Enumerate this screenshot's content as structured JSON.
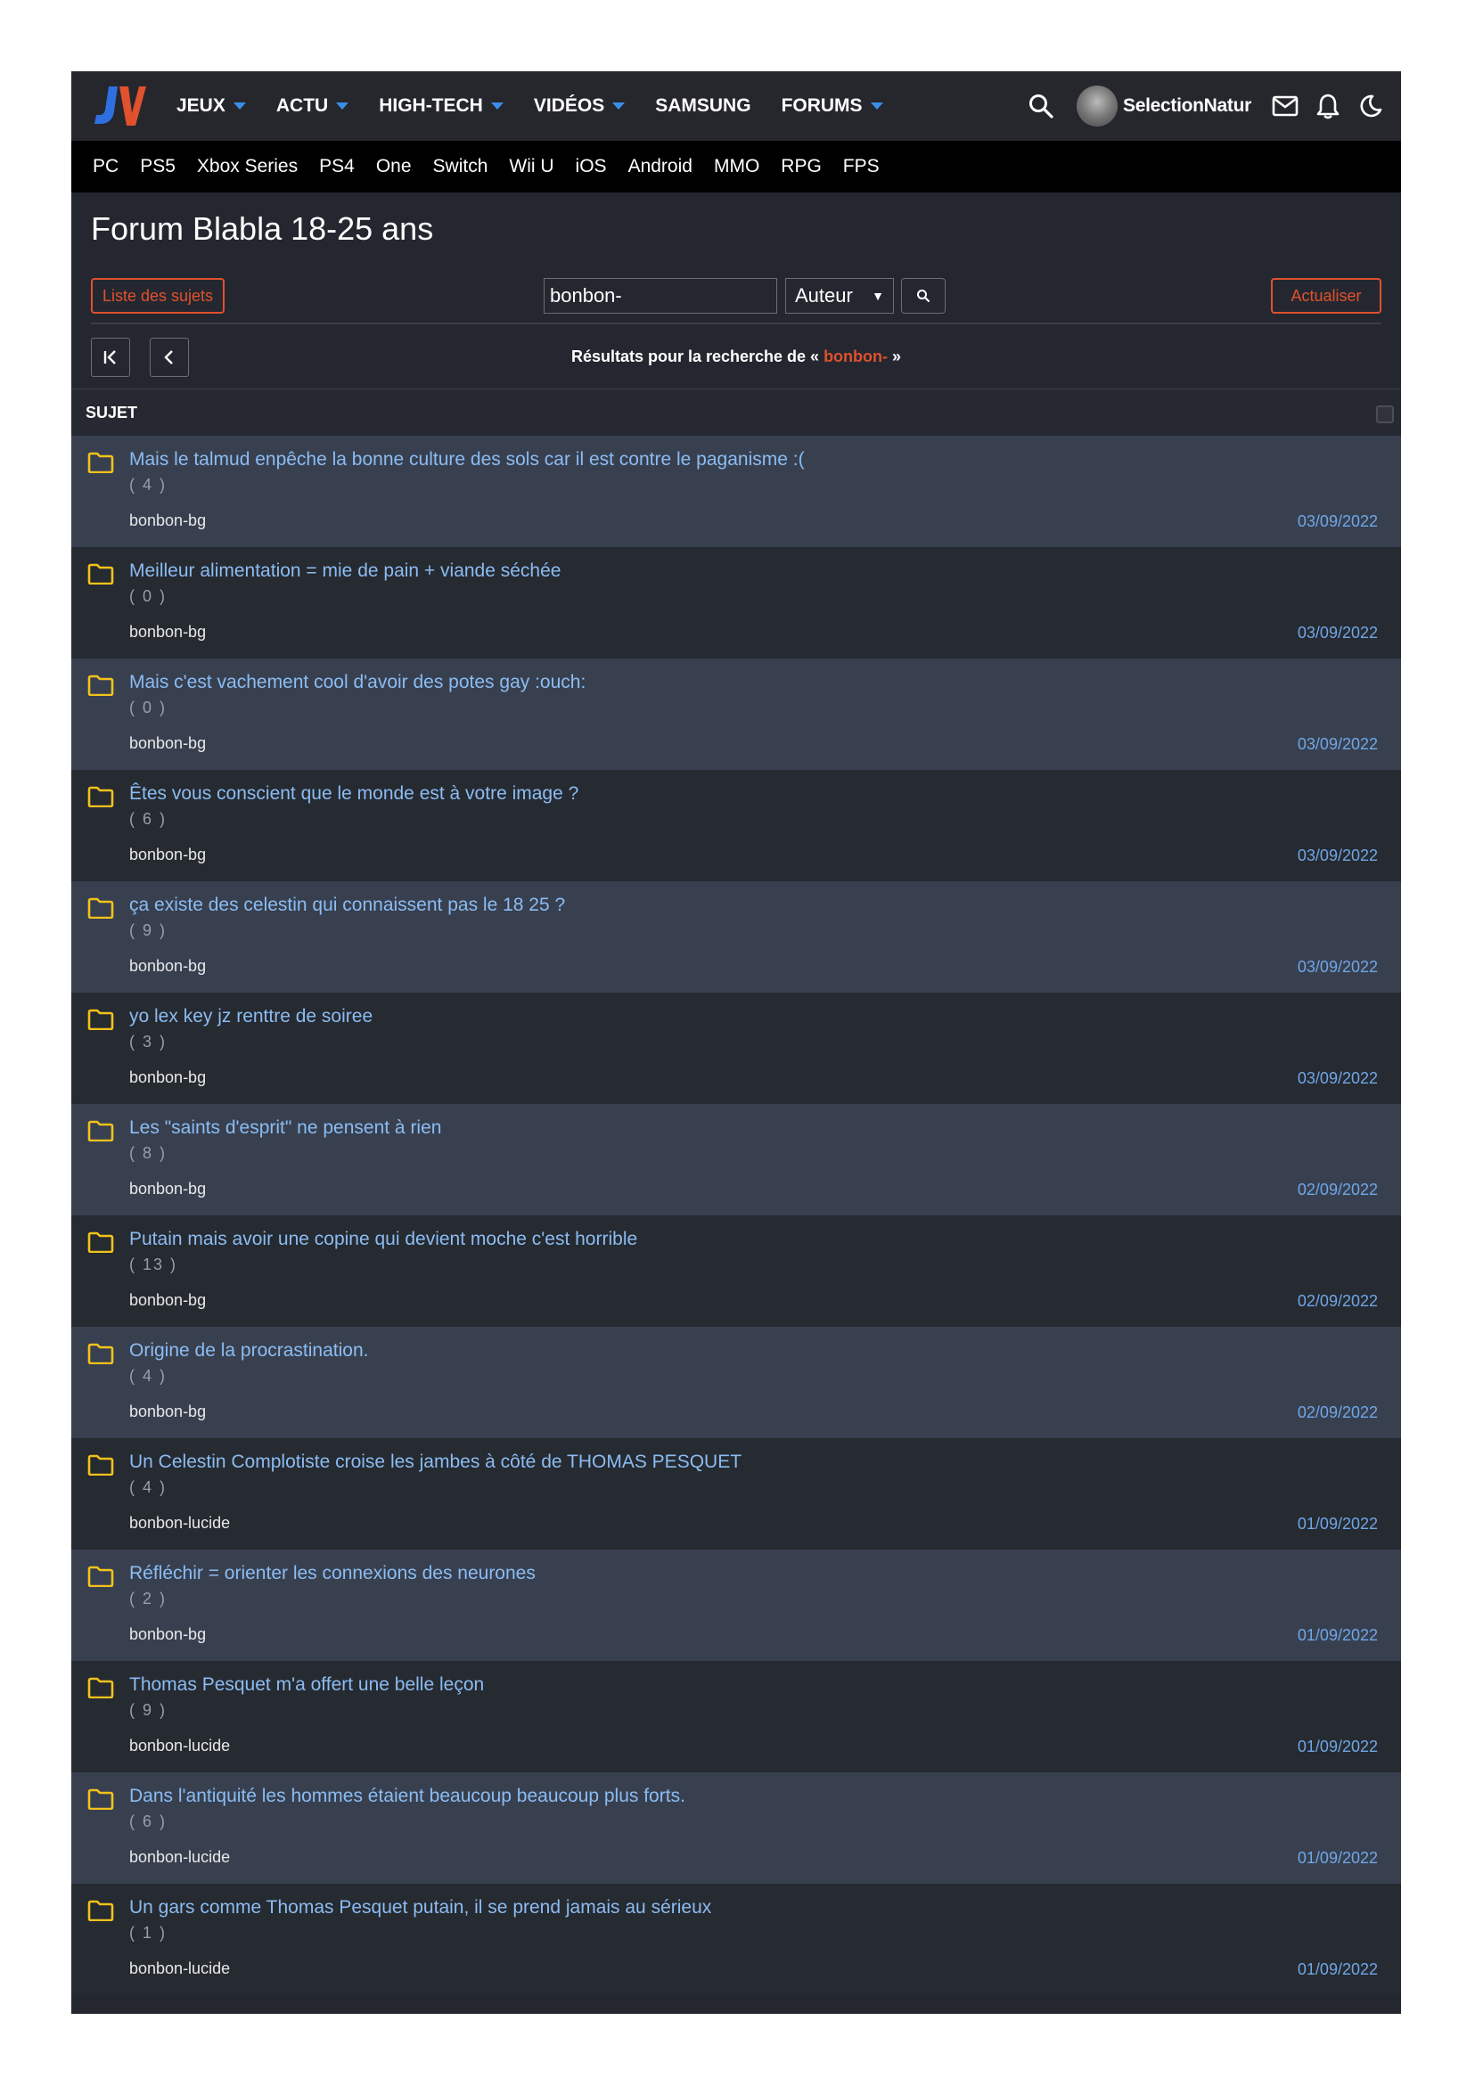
{
  "nav": {
    "items": [
      {
        "label": "JEUX",
        "caret": true
      },
      {
        "label": "ACTU",
        "caret": true
      },
      {
        "label": "HIGH-TECH",
        "caret": true
      },
      {
        "label": "VIDÉOS",
        "caret": true
      },
      {
        "label": "SAMSUNG",
        "caret": false
      },
      {
        "label": "FORUMS",
        "caret": true
      }
    ],
    "username": "SelectionNatur",
    "icons": [
      "search-icon",
      "mail-icon",
      "bell-icon",
      "moon-icon"
    ],
    "accent": "#3b8ee8"
  },
  "platforms": [
    "PC",
    "PS5",
    "Xbox Series",
    "PS4",
    "One",
    "Switch",
    "Wii U",
    "iOS",
    "Android",
    "MMO",
    "RPG",
    "FPS"
  ],
  "forum": {
    "title": "Forum Blabla 18-25 ans",
    "list_button": "Liste des sujets",
    "search_value": "bonbon-",
    "search_scope": "Auteur",
    "refresh_button": "Actualiser",
    "results_prefix": "Résultats pour la recherche de « ",
    "results_query": "bonbon-",
    "results_suffix": " »",
    "column_header": "SUJET",
    "accent": "#e0512d"
  },
  "topics": [
    {
      "title": "Mais le talmud enpêche la bonne culture des sols car il est contre le paganisme :(",
      "count": "( 4 )",
      "author": "bonbon-bg",
      "date": "03/09/2022"
    },
    {
      "title": "Meilleur alimentation = mie de pain + viande séchée",
      "count": "( 0 )",
      "author": "bonbon-bg",
      "date": "03/09/2022"
    },
    {
      "title": "Mais c'est vachement cool d'avoir des potes gay :ouch:",
      "count": "( 0 )",
      "author": "bonbon-bg",
      "date": "03/09/2022"
    },
    {
      "title": "Êtes vous conscient que le monde est à votre image ?",
      "count": "( 6 )",
      "author": "bonbon-bg",
      "date": "03/09/2022"
    },
    {
      "title": "ça existe des celestin qui connaissent pas le 18 25 ?",
      "count": "( 9 )",
      "author": "bonbon-bg",
      "date": "03/09/2022"
    },
    {
      "title": "yo lex key jz renttre de soiree",
      "count": "( 3 )",
      "author": "bonbon-bg",
      "date": "03/09/2022"
    },
    {
      "title": "Les \"saints d'esprit\" ne pensent à rien",
      "count": "( 8 )",
      "author": "bonbon-bg",
      "date": "02/09/2022"
    },
    {
      "title": "Putain mais avoir une copine qui devient moche c'est horrible",
      "count": "( 13 )",
      "author": "bonbon-bg",
      "date": "02/09/2022"
    },
    {
      "title": "Origine de la procrastination.",
      "count": "( 4 )",
      "author": "bonbon-bg",
      "date": "02/09/2022"
    },
    {
      "title": "Un Celestin Complotiste croise les jambes à côté de THOMAS PESQUET",
      "count": "( 4 )",
      "author": "bonbon-lucide",
      "date": "01/09/2022"
    },
    {
      "title": "Réfléchir = orienter les connexions des neurones",
      "count": "( 2 )",
      "author": "bonbon-bg",
      "date": "01/09/2022"
    },
    {
      "title": "Thomas Pesquet m'a offert une belle leçon",
      "count": "( 9 )",
      "author": "bonbon-lucide",
      "date": "01/09/2022"
    },
    {
      "title": "Dans l'antiquité les hommes étaient beaucoup beaucoup plus forts.",
      "count": "( 6 )",
      "author": "bonbon-lucide",
      "date": "01/09/2022"
    },
    {
      "title": "Un gars comme Thomas Pesquet putain, il se prend jamais au sérieux",
      "count": "( 1 )",
      "author": "bonbon-lucide",
      "date": "01/09/2022"
    }
  ]
}
